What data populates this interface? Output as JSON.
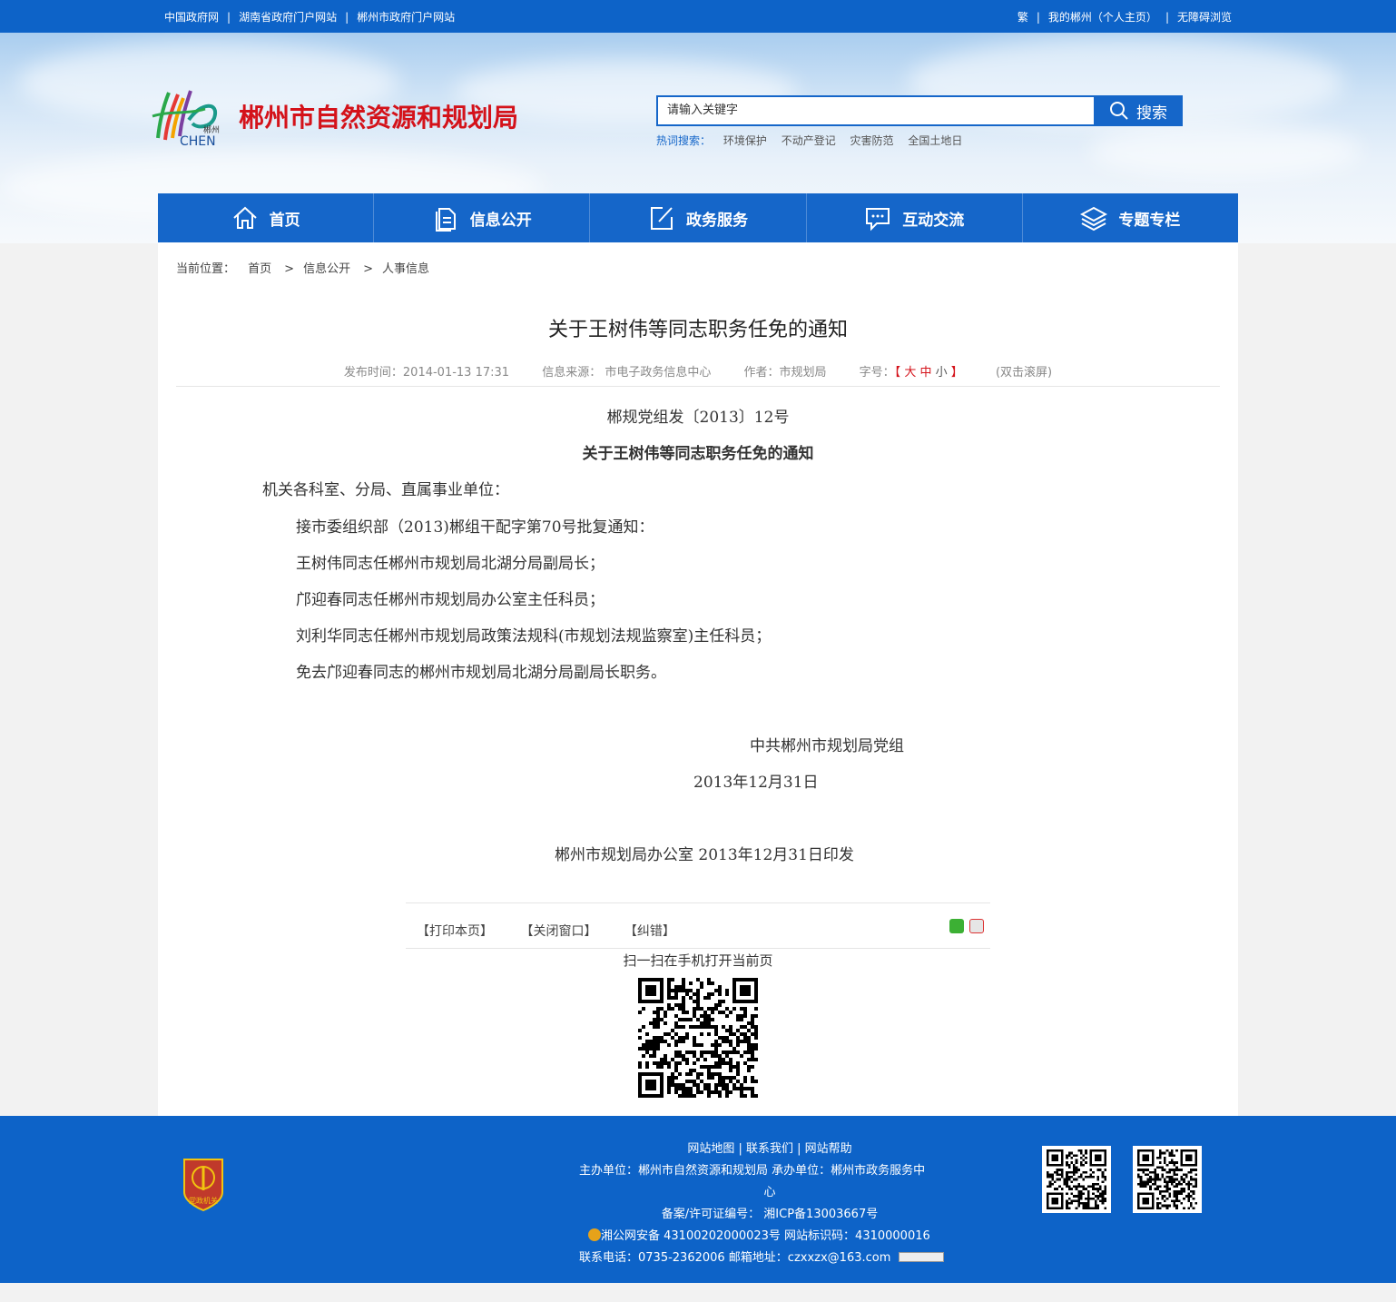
{
  "topbar": {
    "left_links": [
      "中国政府网",
      "湖南省政府门户网站",
      "郴州市政府门户网站"
    ],
    "right_links": [
      "繁",
      "我的郴州（个人主页）",
      "无障碍浏览"
    ],
    "separator": "|"
  },
  "header": {
    "logo_text": "郴州",
    "logo_sub": "CHEN",
    "site_title": "郴州市自然资源和规划局",
    "search_placeholder": "请输入关键字",
    "search_button": "搜索",
    "hot_label": "热词搜索：",
    "hot_keywords": [
      "环境保护",
      "不动产登记",
      "灾害防范",
      "全国土地日"
    ]
  },
  "nav": {
    "items": [
      {
        "label": "首页",
        "icon": "home-icon"
      },
      {
        "label": "信息公开",
        "icon": "document-icon"
      },
      {
        "label": "政务服务",
        "icon": "edit-icon"
      },
      {
        "label": "互动交流",
        "icon": "chat-icon"
      },
      {
        "label": "专题专栏",
        "icon": "layers-icon"
      }
    ],
    "bg_color": "#1566c9"
  },
  "breadcrumb": {
    "label": "当前位置：",
    "items": [
      "首页",
      "信息公开",
      "人事信息"
    ],
    "sep": ">"
  },
  "article": {
    "title": "关于王树伟等同志职务任免的通知",
    "meta": {
      "publish": "发布时间：2014-01-13 17:31",
      "source": "信息来源： 市电子政务信息中心",
      "author": "作者：市规划局",
      "font_label": "字号：",
      "bracket_open": "【",
      "big": "大",
      "mid": "中",
      "small": "小",
      "bracket_close": "】",
      "scroll": "(双击滚屏)"
    },
    "doc_number": "郴规党组发〔2013〕12号",
    "doc_title": "关于王树伟等同志职务任免的通知",
    "salutation": "机关各科室、分局、直属事业单位：",
    "paragraphs": [
      "接市委组织部（2013)郴组干配字第70号批复通知：",
      "王树伟同志任郴州市规划局北湖分局副局长；",
      "邝迎春同志任郴州市规划局办公室主任科员；",
      "刘利华同志任郴州市规划局政策法规科(市规划法规监察室)主任科员；",
      "免去邝迎春同志的郴州市规划局北湖分局副局长职务。"
    ],
    "signature": "中共郴州市规划局党组",
    "date": "2013年12月31日",
    "issued": "郴州市规划局办公室  2013年12月31日印发"
  },
  "tools": {
    "print": "【打印本页】",
    "close": "【关闭窗口】",
    "correct": "【纠错】",
    "scan_text": "扫一扫在手机打开当前页"
  },
  "footer": {
    "links": "网站地图 | 联系我们 | 网站帮助",
    "host_line1": "主办单位：郴州市自然资源和规划局    承办单位：郴州市政务服务中",
    "host_line2": "心",
    "icp": "备案/许可证编号：  湘ICP备13003667号",
    "police": "湘公网安备 43100202000023号    网站标识码：4310000016",
    "contact": "联系电话：0735-2362006    邮箱地址：czxxzx@163.com",
    "badge_text": "党政机关"
  },
  "colors": {
    "brand_blue": "#0d63c8",
    "title_red": "#d4121a"
  }
}
